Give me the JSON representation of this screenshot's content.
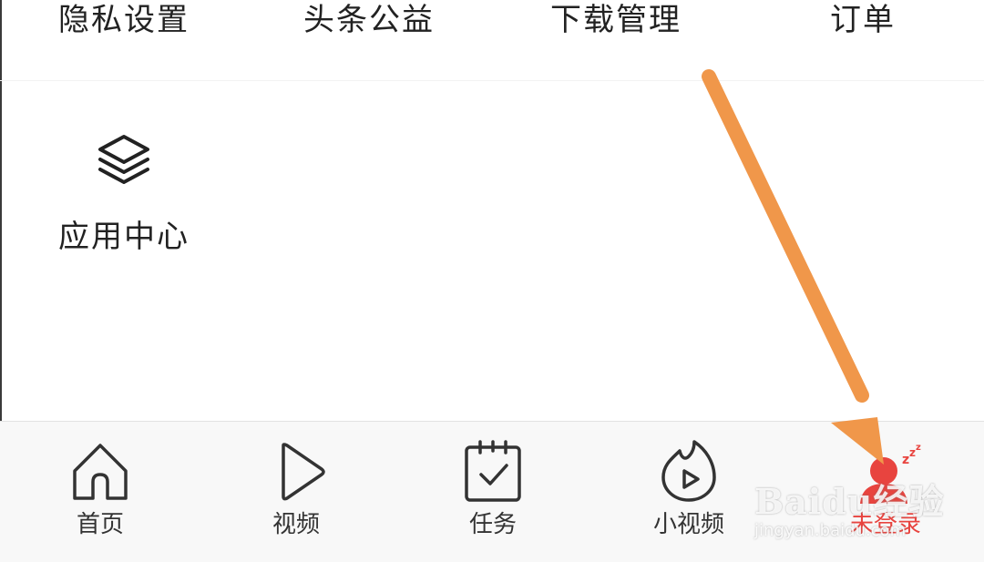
{
  "top_menu": {
    "items": [
      {
        "label": "隐私设置"
      },
      {
        "label": "头条公益"
      },
      {
        "label": "下载管理"
      },
      {
        "label": "订单"
      }
    ]
  },
  "apps": {
    "app_center": {
      "label": "应用中心",
      "icon": "layers-icon"
    }
  },
  "tabbar": {
    "tabs": [
      {
        "label": "首页",
        "icon": "home-icon"
      },
      {
        "label": "视频",
        "icon": "play-icon"
      },
      {
        "label": "任务",
        "icon": "task-calendar-icon"
      },
      {
        "label": "小视频",
        "icon": "flame-play-icon"
      },
      {
        "label": "未登录",
        "icon": "sleeping-user-icon",
        "active": true
      }
    ]
  },
  "annotation": {
    "arrow_color": "#f0974a"
  },
  "watermark": {
    "brand": "Baidu经验",
    "url": "jingyan.baidu.com"
  },
  "colors": {
    "accent": "#e8443f",
    "text": "#222222",
    "tabbar_bg": "#f8f8f8"
  }
}
